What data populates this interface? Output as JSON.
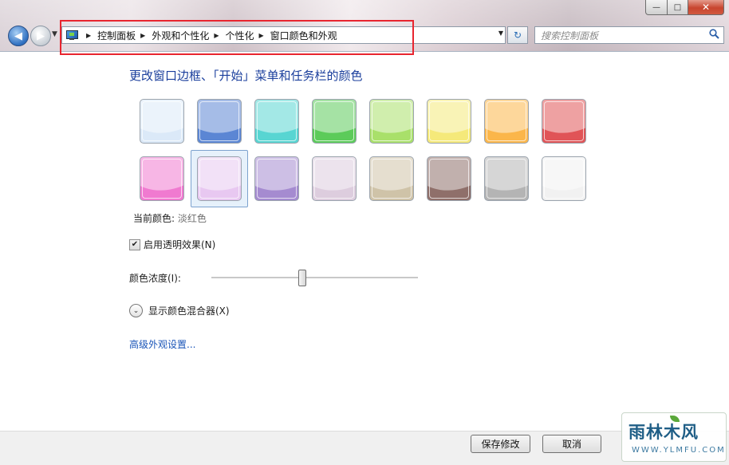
{
  "window": {
    "caption_buttons": {
      "minimize": "—",
      "maximize": "□",
      "close": "✕"
    }
  },
  "nav": {
    "back_glyph": "◀",
    "forward_glyph": "▶",
    "dropdown_glyph": "▼"
  },
  "address_bar": {
    "icon": "control-panel-icon",
    "separator": "▶",
    "breadcrumbs": [
      "控制面板",
      "外观和个性化",
      "个性化",
      "窗口颜色和外观"
    ],
    "dropdown_glyph": "▼",
    "refresh_glyph": "↻"
  },
  "search": {
    "placeholder": "搜索控制面板",
    "icon": "search-icon"
  },
  "main": {
    "heading": "更改窗口边框、「开始」菜单和任务栏的颜色",
    "colors_row1": [
      "#dbe9f8",
      "#5b86d4",
      "#58d5d2",
      "#5ccb5a",
      "#a9e06a",
      "#f5e97a",
      "#fbb64a",
      "#e05457"
    ],
    "colors_row2": [
      "#f07ad0",
      "#e8c8f1",
      "#a58bd0",
      "#ddcdde",
      "#cfc3a8",
      "#8f6f6a",
      "#b4b4b4",
      "#f1f1f1"
    ],
    "selected_index": 9,
    "current_color_label": "当前颜色:",
    "current_color_value": "淡红色",
    "transparency_label": "启用透明效果(N)",
    "transparency_checked": true,
    "intensity_label": "颜色浓度(I):",
    "intensity_level": 0.44,
    "mixer_label": "显示颜色混合器(X)",
    "advanced_link": "高级外观设置..."
  },
  "footer": {
    "save_label": "保存修改",
    "cancel_label": "取消"
  },
  "watermark": {
    "title": "雨林木风",
    "url": "WWW.YLMFU.COM"
  }
}
